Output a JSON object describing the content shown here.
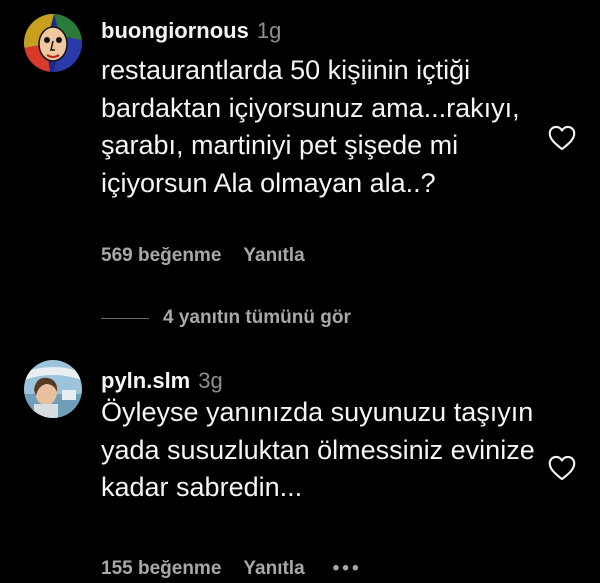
{
  "comments": [
    {
      "username": "buongiornous",
      "time": "1g",
      "text": "restaurantlarda 50 kişiinin içtiği bardaktan içiyorsunuz ama...rakıyı, şarabı, martiniyi pet şişede mi içiyorsun Ala olmayan ala..?",
      "likes": "569 beğenme",
      "reply_label": "Yanıtla",
      "avatar_icon": "abstract-face-avatar",
      "like_icon": "heart-outline-icon"
    },
    {
      "username": "pyln.slm",
      "time": "3g",
      "text": "Öyleyse yanınızda suyunuzu taşıyın yada susuzluktan ölmessiniz evinize kadar sabredin...",
      "likes": "155 beğenme",
      "reply_label": "Yanıtla",
      "more_label": "•••",
      "avatar_icon": "profile-photo-avatar",
      "like_icon": "heart-outline-icon"
    }
  ],
  "view_replies_label": "4 yanıtın tümünü gör",
  "colors": {
    "background": "#000000",
    "primary_text": "#f5f5f5",
    "secondary_text": "#a8a8a8",
    "timestamp": "#8e8e8e"
  }
}
